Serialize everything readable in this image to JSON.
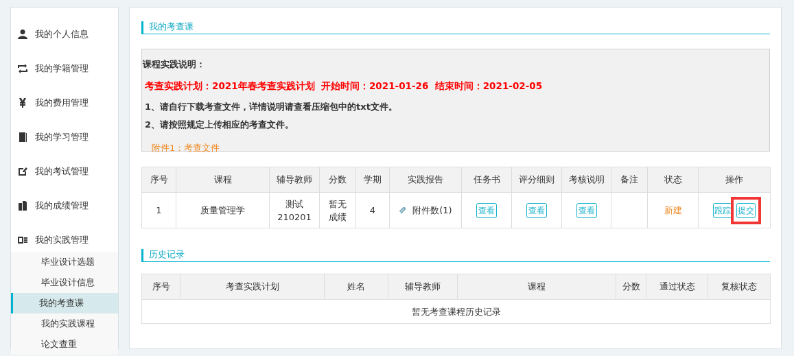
{
  "sidebar": {
    "items": [
      {
        "label": "我的个人信息"
      },
      {
        "label": "我的学籍管理"
      },
      {
        "label": "我的费用管理"
      },
      {
        "label": "我的学习管理"
      },
      {
        "label": "我的考试管理"
      },
      {
        "label": "我的成绩管理"
      },
      {
        "label": "我的实践管理",
        "children": [
          {
            "label": "毕业设计选题",
            "selected": false
          },
          {
            "label": "毕业设计信息",
            "selected": false
          },
          {
            "label": "我的考查课",
            "selected": true
          },
          {
            "label": "我的实践课程",
            "selected": false
          },
          {
            "label": "论文查重",
            "selected": false
          }
        ]
      }
    ]
  },
  "section_title": "我的考查课",
  "notice": {
    "heading": "课程实践说明：",
    "plan_line": "考查实践计划：2021年春考查实践计划  开始时间：2021-01-26  结束时间：2021-02-05",
    "lines": [
      "1、请自行下载考查文件，详情说明请查看压缩包中的txt文件。",
      "2、请按照规定上传相应的考查文件。"
    ],
    "attachment": "附件1：考查文件"
  },
  "table": {
    "columns": [
      "序号",
      "课程",
      "辅导教师",
      "分数",
      "学期",
      "实践报告",
      "任务书",
      "评分细则",
      "考核说明",
      "备注",
      "状态",
      "操作"
    ],
    "rows": [
      {
        "index": "1",
        "course": "质量管理学",
        "teacher": [
          "测试",
          "210201"
        ],
        "score": [
          "暂无",
          "成绩"
        ],
        "term": "4",
        "report": "附件数(1)",
        "task_book": "查看",
        "rubric": "查看",
        "assessment": "查看",
        "status": "新建",
        "actions": [
          {
            "label": "跟踪",
            "highlighted": false
          },
          {
            "label": "提交",
            "highlighted": true
          }
        ]
      }
    ]
  },
  "history_title": "历史记录",
  "history_table": {
    "columns": [
      "序号",
      "考查实践计划",
      "姓名",
      "辅导教师",
      "课程",
      "分数",
      "通过状态",
      "复核状态"
    ],
    "empty_text": "暂无考查课程历史记录"
  }
}
